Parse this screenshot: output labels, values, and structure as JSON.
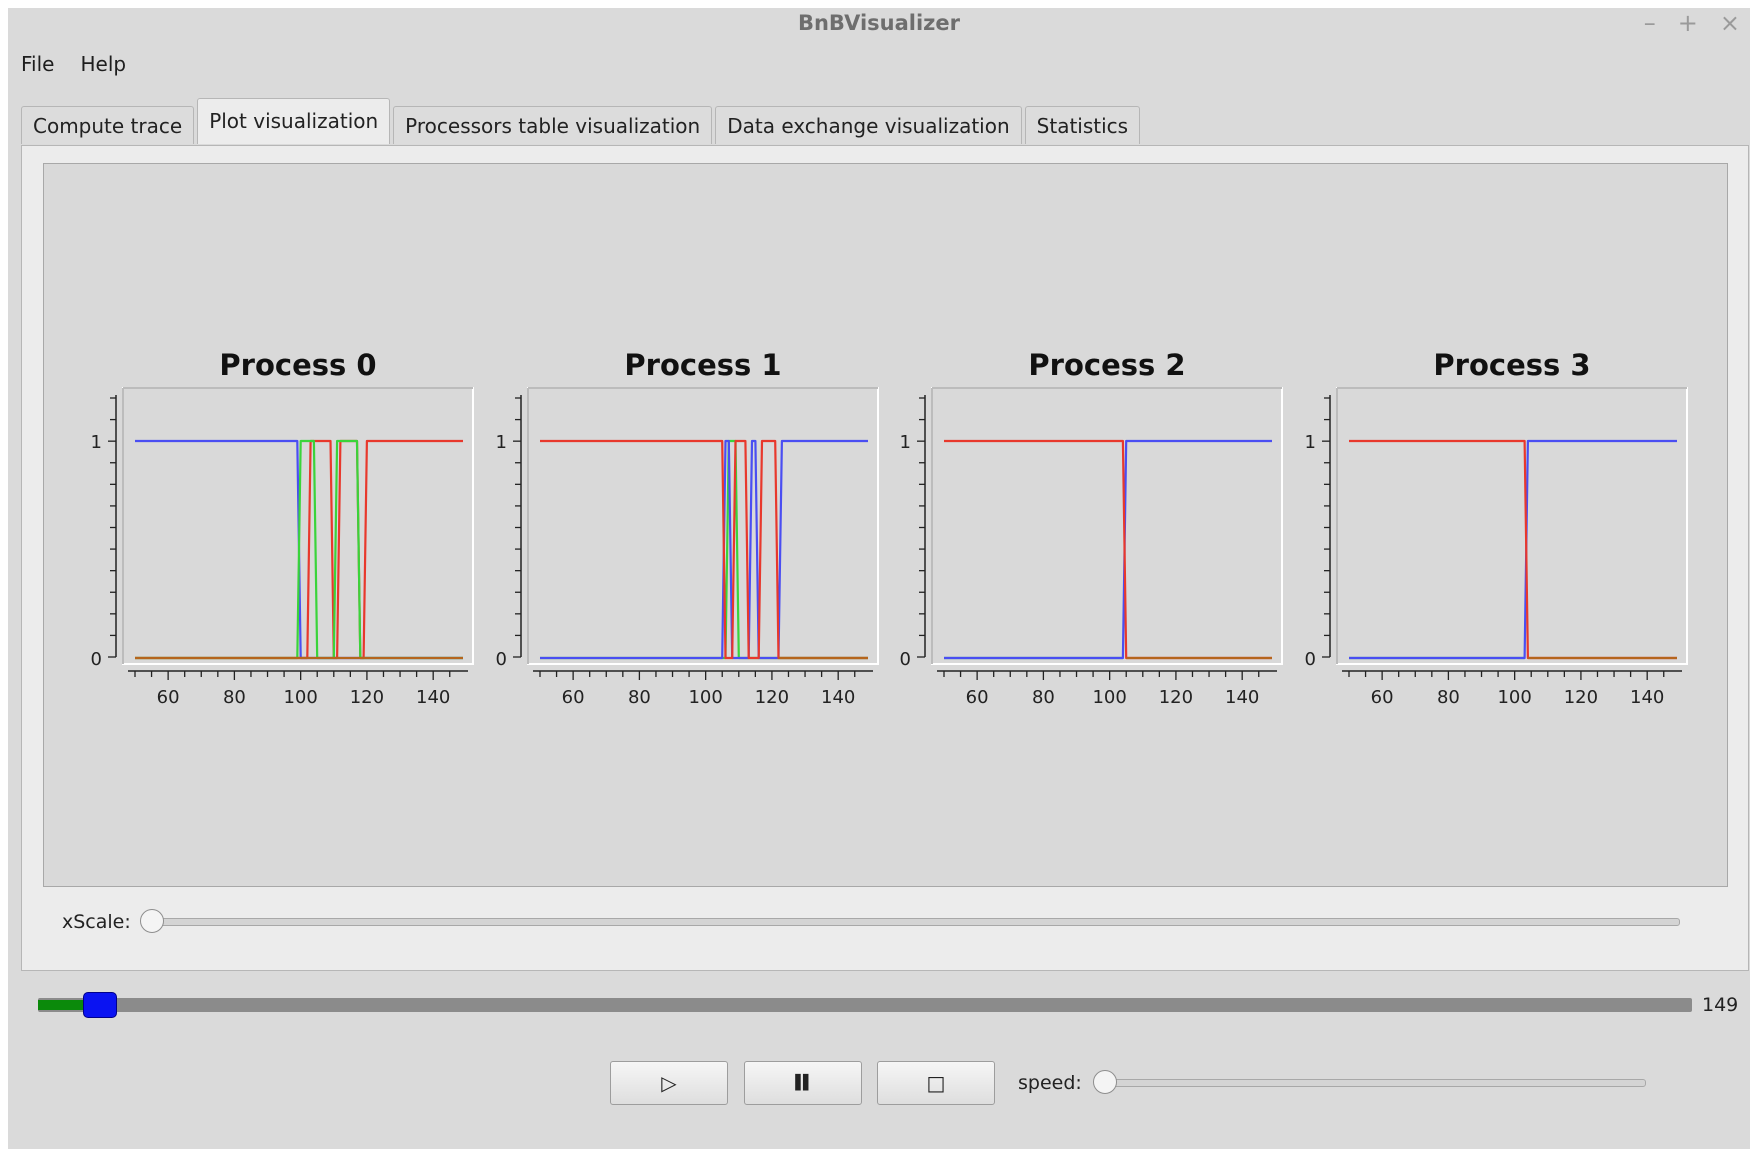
{
  "window": {
    "title": "BnBVisualizer",
    "controls": {
      "minimize": "–",
      "maximize": "+",
      "close": "×"
    }
  },
  "menu": [
    {
      "label": "File"
    },
    {
      "label": "Help"
    }
  ],
  "tabs": [
    {
      "label": "Compute trace",
      "active": false
    },
    {
      "label": "Plot visualization",
      "active": true
    },
    {
      "label": "Processors table visualization",
      "active": false
    },
    {
      "label": "Data exchange visualization",
      "active": false
    },
    {
      "label": "Statistics",
      "active": false
    }
  ],
  "plot_controls": {
    "xscale_label": "xScale:",
    "xscale_fraction": 0.0
  },
  "timeline": {
    "value_label": "149",
    "position_fraction": 0.028
  },
  "playback": {
    "play_icon": "play-icon",
    "pause_icon": "pause-icon",
    "stop_icon": "stop-icon",
    "play_glyph": "▷",
    "pause_glyph": "▌▌",
    "stop_glyph": "□",
    "speed_label": "speed:",
    "speed_fraction": 0.0
  },
  "colors": {
    "blue": "#4a4ef2",
    "red": "#e8382c",
    "green": "#3ad43a",
    "orange": "#b5651d",
    "teal": "#20a878",
    "progress_fill": "#0b8a0b",
    "progress_handle": "#0a13f2"
  },
  "chart_data": [
    {
      "type": "line",
      "title": "Process 0",
      "xlim": [
        50,
        149
      ],
      "ylim": [
        0,
        1
      ],
      "xticks": [
        "60",
        "80",
        "100",
        "120",
        "140"
      ],
      "yticks": [
        "0",
        "1"
      ],
      "series": [
        {
          "color": "#4a4ef2",
          "x": [
            50,
            99,
            100,
            149
          ],
          "y": [
            1,
            1,
            0,
            0
          ]
        },
        {
          "color": "#e8382c",
          "x": [
            50,
            102,
            103,
            109,
            110,
            111,
            112,
            117,
            118,
            119,
            120,
            149
          ],
          "y": [
            0,
            0,
            1,
            1,
            0,
            0,
            1,
            1,
            0,
            0,
            1,
            1
          ]
        },
        {
          "color": "#3ad43a",
          "x": [
            50,
            99,
            100,
            104,
            105,
            110,
            111,
            117,
            118,
            120,
            121,
            149
          ],
          "y": [
            0,
            0,
            1,
            1,
            0,
            0,
            1,
            1,
            0,
            0,
            0,
            0
          ]
        },
        {
          "color": "#b5651d",
          "x": [
            50,
            149
          ],
          "y": [
            0,
            0
          ]
        }
      ]
    },
    {
      "type": "line",
      "title": "Process 1",
      "xlim": [
        50,
        149
      ],
      "ylim": [
        0,
        1
      ],
      "xticks": [
        "60",
        "80",
        "100",
        "120",
        "140"
      ],
      "yticks": [
        "0",
        "1"
      ],
      "series": [
        {
          "color": "#3ad43a",
          "x": [
            50,
            106,
            107,
            109,
            110,
            149
          ],
          "y": [
            0,
            0,
            1,
            1,
            0,
            0
          ]
        },
        {
          "color": "#4a4ef2",
          "x": [
            50,
            105,
            106,
            107,
            108,
            113,
            114,
            115,
            116,
            122,
            123,
            149
          ],
          "y": [
            0,
            0,
            1,
            1,
            0,
            0,
            1,
            1,
            0,
            0,
            1,
            1
          ]
        },
        {
          "color": "#e8382c",
          "x": [
            50,
            105,
            106,
            108,
            109,
            112,
            113,
            116,
            117,
            121,
            122,
            149
          ],
          "y": [
            1,
            1,
            0,
            0,
            1,
            1,
            0,
            0,
            1,
            1,
            0,
            0
          ]
        },
        {
          "color": "#b5651d",
          "x": [
            122,
            149
          ],
          "y": [
            0,
            0
          ]
        }
      ]
    },
    {
      "type": "line",
      "title": "Process 2",
      "xlim": [
        50,
        149
      ],
      "ylim": [
        0,
        1
      ],
      "xticks": [
        "60",
        "80",
        "100",
        "120",
        "140"
      ],
      "yticks": [
        "0",
        "1"
      ],
      "series": [
        {
          "color": "#20a878",
          "x": [
            50,
            104
          ],
          "y": [
            0,
            0
          ]
        },
        {
          "color": "#4a4ef2",
          "x": [
            50,
            104,
            105,
            149
          ],
          "y": [
            0,
            0,
            1,
            1
          ]
        },
        {
          "color": "#e8382c",
          "x": [
            50,
            104,
            105,
            149
          ],
          "y": [
            1,
            1,
            0,
            0
          ]
        },
        {
          "color": "#b5651d",
          "x": [
            105,
            149
          ],
          "y": [
            0,
            0
          ]
        }
      ]
    },
    {
      "type": "line",
      "title": "Process 3",
      "xlim": [
        50,
        149
      ],
      "ylim": [
        0,
        1
      ],
      "xticks": [
        "60",
        "80",
        "100",
        "120",
        "140"
      ],
      "yticks": [
        "0",
        "1"
      ],
      "series": [
        {
          "color": "#20a878",
          "x": [
            50,
            103
          ],
          "y": [
            0,
            0
          ]
        },
        {
          "color": "#4a4ef2",
          "x": [
            50,
            103,
            104,
            149
          ],
          "y": [
            0,
            0,
            1,
            1
          ]
        },
        {
          "color": "#e8382c",
          "x": [
            50,
            103,
            104,
            149
          ],
          "y": [
            1,
            1,
            0,
            0
          ]
        },
        {
          "color": "#b5651d",
          "x": [
            104,
            149
          ],
          "y": [
            0,
            0
          ]
        }
      ]
    }
  ]
}
